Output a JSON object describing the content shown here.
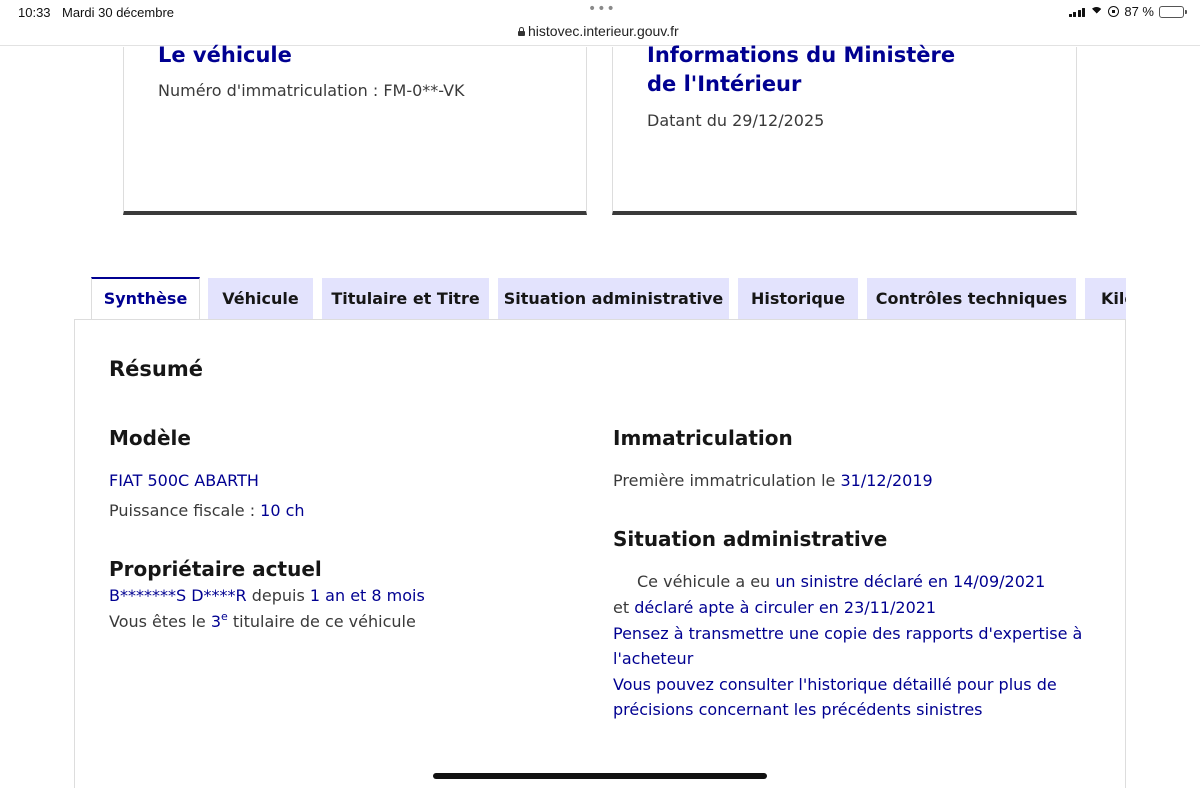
{
  "status_bar": {
    "time": "10:33",
    "date": "Mardi 30 décembre",
    "dots": "•••",
    "url": "histovec.interieur.gouv.fr",
    "battery": "87 %",
    "battery_level": 0.87
  },
  "cards": {
    "vehicle": {
      "title": "Le véhicule",
      "plate_text": "Numéro d'immatriculation : FM-0**-VK"
    },
    "ministry": {
      "title": "Informations du Ministère de l'Intérieur",
      "date_text": "Datant du 29/12/2025"
    }
  },
  "tabs": [
    {
      "label": "Synthèse"
    },
    {
      "label": "Véhicule"
    },
    {
      "label": "Titulaire et Titre"
    },
    {
      "label": "Situation administrative"
    },
    {
      "label": "Historique"
    },
    {
      "label": "Contrôles techniques"
    },
    {
      "label": "Kilo"
    }
  ],
  "summary": {
    "title": "Résumé",
    "model": {
      "heading": "Modèle",
      "name": "FIAT 500C ABARTH",
      "power_label": "Puissance fiscale : ",
      "power_value": "10 ch"
    },
    "owner": {
      "heading": "Propriétaire actuel",
      "name": "B*******S D****R",
      "since_label": " depuis ",
      "since_value": "1 an et 8 mois",
      "rank_prefix": "Vous êtes le ",
      "rank_number": "3",
      "rank_sup": "e",
      "rank_suffix": " titulaire de ce véhicule"
    },
    "registration": {
      "heading": "Immatriculation",
      "first_label": "Première immatriculation le ",
      "first_date": "31/12/2019"
    },
    "admin": {
      "heading": "Situation administrative",
      "line1_prefix": "Ce véhicule a eu ",
      "line1_link": "un sinistre déclaré en 14/09/2021",
      "line2_prefix": "et ",
      "line2_link": "déclaré apte à circuler en 23/11/2021",
      "line3": "Pensez à transmettre une copie des rapports d'expertise à",
      "line4": "l'acheteur",
      "line5": "Vous pouvez consulter l'historique détaillé pour plus de",
      "line6": "précisions concernant les précédents sinistres"
    }
  }
}
